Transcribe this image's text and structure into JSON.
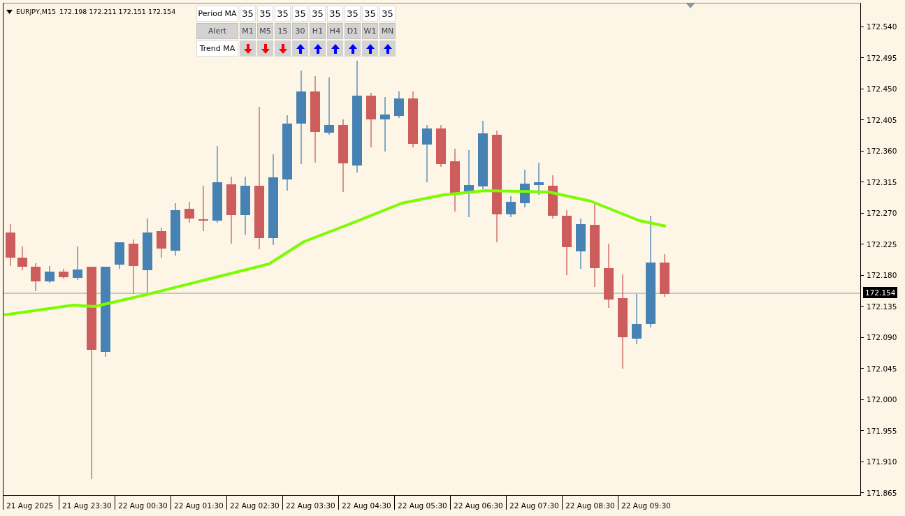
{
  "header": {
    "symbol": "EURJPY,M15",
    "prices": [
      "172.198",
      "172.211",
      "172.151",
      "172.154"
    ]
  },
  "panel": {
    "period_label": "Period MA",
    "periods": [
      "35",
      "35",
      "35",
      "35",
      "35",
      "35",
      "35",
      "35",
      "35"
    ],
    "alert_label": "Alert",
    "timeframes": [
      "M1",
      "M5",
      "15",
      "30",
      "H1",
      "H4",
      "D1",
      "W1",
      "MN"
    ],
    "trend_label": "Trend MA",
    "trends": [
      {
        "rising": false
      },
      {
        "rising": false
      },
      {
        "rising": false
      },
      {
        "rising": true
      },
      {
        "rising": true
      },
      {
        "rising": true
      },
      {
        "rising": true
      },
      {
        "rising": true
      },
      {
        "rising": true
      }
    ]
  },
  "price_axis": {
    "ticks": [
      "172.540",
      "172.495",
      "172.450",
      "172.405",
      "172.360",
      "172.315",
      "172.270",
      "172.225",
      "172.180",
      "172.135",
      "172.090",
      "172.045",
      "172.000",
      "171.955",
      "171.910",
      "171.865"
    ],
    "current_price": "172.154"
  },
  "time_axis": {
    "labels": [
      "21 Aug 2025",
      "21 Aug 23:30",
      "22 Aug 00:30",
      "22 Aug 01:30",
      "22 Aug 02:30",
      "22 Aug 03:30",
      "22 Aug 04:30",
      "22 Aug 05:30",
      "22 Aug 06:30",
      "22 Aug 07:30",
      "22 Aug 08:30",
      "22 Aug 09:30"
    ]
  }
}
